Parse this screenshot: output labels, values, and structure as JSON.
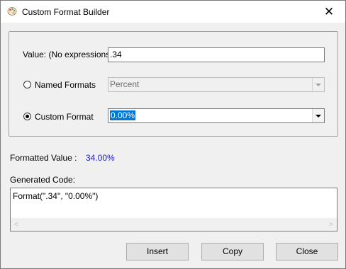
{
  "window": {
    "title": "Custom Format Builder",
    "title_icon": "palette-icon",
    "close_glyph": "✕"
  },
  "form": {
    "value_label": "Value: (No expressions)",
    "value_input": ".34",
    "named_formats_label": "Named Formats",
    "named_formats_value": "Percent",
    "custom_format_label": "Custom Format",
    "custom_format_value": "0.00%"
  },
  "result": {
    "formatted_label": "Formatted Value :",
    "formatted_value": "34.00%",
    "value_color": "#1a1acc"
  },
  "code": {
    "label": "Generated Code:",
    "text": "Format(\".34\", \"0.00%\")"
  },
  "buttons": {
    "insert": "Insert",
    "copy": "Copy",
    "close": "Close"
  }
}
